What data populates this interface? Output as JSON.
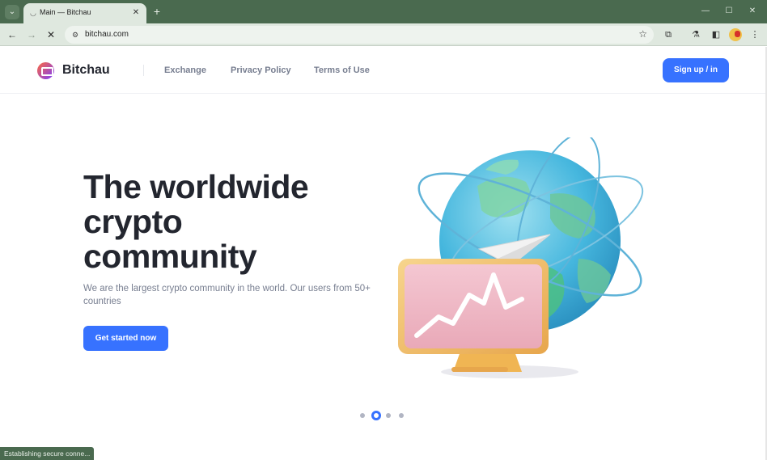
{
  "browser": {
    "tab_title": "Main — Bitchau",
    "url": "bitchau.com",
    "status_text": "Establishing secure conne..."
  },
  "site": {
    "logo_text": "Bitchau",
    "nav": [
      "Exchange",
      "Privacy Policy",
      "Terms of Use"
    ],
    "signup_label": "Sign up / in"
  },
  "hero": {
    "title_lines": [
      "The worldwide",
      "crypto",
      "community"
    ],
    "subtitle": "We are the largest crypto community in the world. Our users from 50+ countries",
    "cta_label": "Get started now"
  },
  "carousel": {
    "count": 4,
    "active_index": 1
  },
  "colors": {
    "accent": "#3772ff",
    "chrome": "#4a6a4f",
    "text": "#23262f",
    "muted": "#777e90"
  }
}
